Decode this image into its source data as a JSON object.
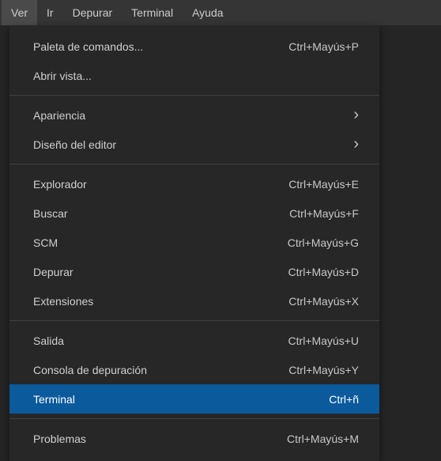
{
  "menubar": {
    "items": [
      {
        "label": "Ver",
        "active": true
      },
      {
        "label": "Ir",
        "active": false
      },
      {
        "label": "Depurar",
        "active": false
      },
      {
        "label": "Terminal",
        "active": false
      },
      {
        "label": "Ayuda",
        "active": false
      }
    ]
  },
  "dropdown": {
    "groups": [
      [
        {
          "label": "Paleta de comandos...",
          "shortcut": "Ctrl+Mayús+P",
          "submenu": false,
          "highlight": false
        },
        {
          "label": "Abrir vista...",
          "shortcut": "",
          "submenu": false,
          "highlight": false
        }
      ],
      [
        {
          "label": "Apariencia",
          "shortcut": "",
          "submenu": true,
          "highlight": false
        },
        {
          "label": "Diseño del editor",
          "shortcut": "",
          "submenu": true,
          "highlight": false
        }
      ],
      [
        {
          "label": "Explorador",
          "shortcut": "Ctrl+Mayús+E",
          "submenu": false,
          "highlight": false
        },
        {
          "label": "Buscar",
          "shortcut": "Ctrl+Mayús+F",
          "submenu": false,
          "highlight": false
        },
        {
          "label": "SCM",
          "shortcut": "Ctrl+Mayús+G",
          "submenu": false,
          "highlight": false
        },
        {
          "label": "Depurar",
          "shortcut": "Ctrl+Mayús+D",
          "submenu": false,
          "highlight": false
        },
        {
          "label": "Extensiones",
          "shortcut": "Ctrl+Mayús+X",
          "submenu": false,
          "highlight": false
        }
      ],
      [
        {
          "label": "Salida",
          "shortcut": "Ctrl+Mayús+U",
          "submenu": false,
          "highlight": false
        },
        {
          "label": "Consola de depuración",
          "shortcut": "Ctrl+Mayús+Y",
          "submenu": false,
          "highlight": false
        },
        {
          "label": "Terminal",
          "shortcut": "Ctrl+ñ",
          "submenu": false,
          "highlight": true
        }
      ],
      [
        {
          "label": "Problemas",
          "shortcut": "Ctrl+Mayús+M",
          "submenu": false,
          "highlight": false
        }
      ]
    ]
  }
}
